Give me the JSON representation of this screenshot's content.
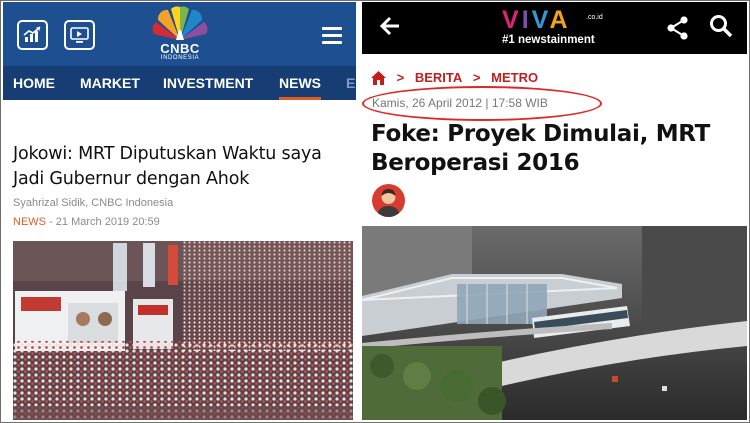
{
  "cnbc": {
    "header": {
      "logo_text": "CNBC",
      "logo_subtext": "INDONESIA",
      "left_icons": [
        "chart-icon",
        "tv-icon"
      ],
      "menu_icon": "hamburger-icon",
      "background": "#1d4f91"
    },
    "nav": {
      "items": [
        {
          "label": "HOME",
          "active": false
        },
        {
          "label": "MARKET",
          "active": false
        },
        {
          "label": "INVESTMENT",
          "active": false
        },
        {
          "label": "NEWS",
          "active": true
        },
        {
          "label": "E",
          "active": false
        }
      ],
      "accent": "#e05b23"
    },
    "article": {
      "headline": "Jokowi: MRT Diputuskan Waktu saya Jadi Gubernur dengan Ahok",
      "author": "Syahrizal Sidik, CNBC Indonesia",
      "category": "NEWS",
      "separator": "-",
      "date": "21 March 2019 20:59"
    }
  },
  "viva": {
    "header": {
      "logo_text": "VIVA",
      "logo_domain": ".co.id",
      "tagline": "#1 newstainment",
      "back_icon": "back-arrow-icon",
      "share_icon": "share-icon",
      "search_icon": "search-icon",
      "background": "#000000"
    },
    "breadcrumb": {
      "home_icon": "home-icon",
      "items": [
        "BERITA",
        "METRO"
      ],
      "separator": ">",
      "color": "#c21e1e"
    },
    "article": {
      "date": "Kamis, 26 April 2012 | 17:58 WIB",
      "headline": "Foke: Proyek Dimulai, MRT Beroperasi 2016",
      "avatar_icon": "user-avatar-icon",
      "highlight_color": "#e02626"
    }
  }
}
